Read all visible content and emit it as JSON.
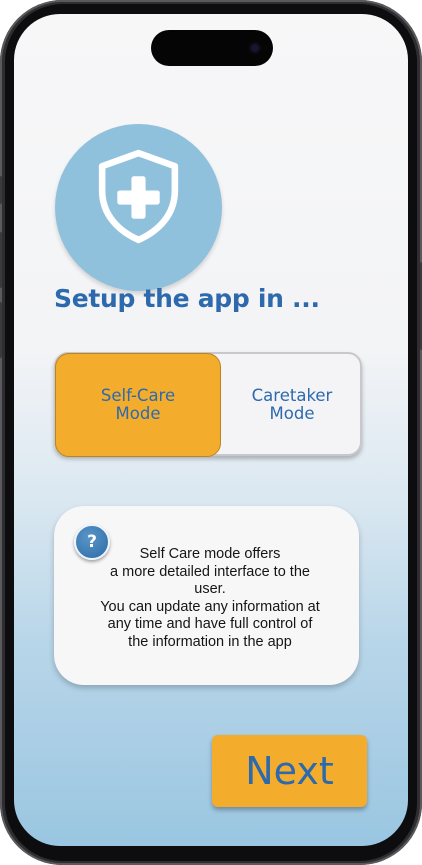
{
  "setup": {
    "title": "Setup the app in ..."
  },
  "mode_toggle": {
    "options": [
      {
        "label": "Self-Care\nMode",
        "selected": true
      },
      {
        "label": "Caretaker\nMode",
        "selected": false
      }
    ]
  },
  "info_card": {
    "icon": "question-mark-icon",
    "icon_glyph": "?",
    "lines": [
      "Self Care mode offers",
      "a more detailed interface to the",
      "user.",
      "You can update any information at",
      "any time and have full control of",
      "the information in the app"
    ]
  },
  "footer": {
    "next_label": "Next"
  },
  "colors": {
    "accent": "#f4ac2c",
    "brand_blue": "#2d6aad",
    "logo_circle": "#8fc1dd"
  },
  "icons": {
    "logo": "shield-plus-icon",
    "front_camera": "camera-icon"
  }
}
